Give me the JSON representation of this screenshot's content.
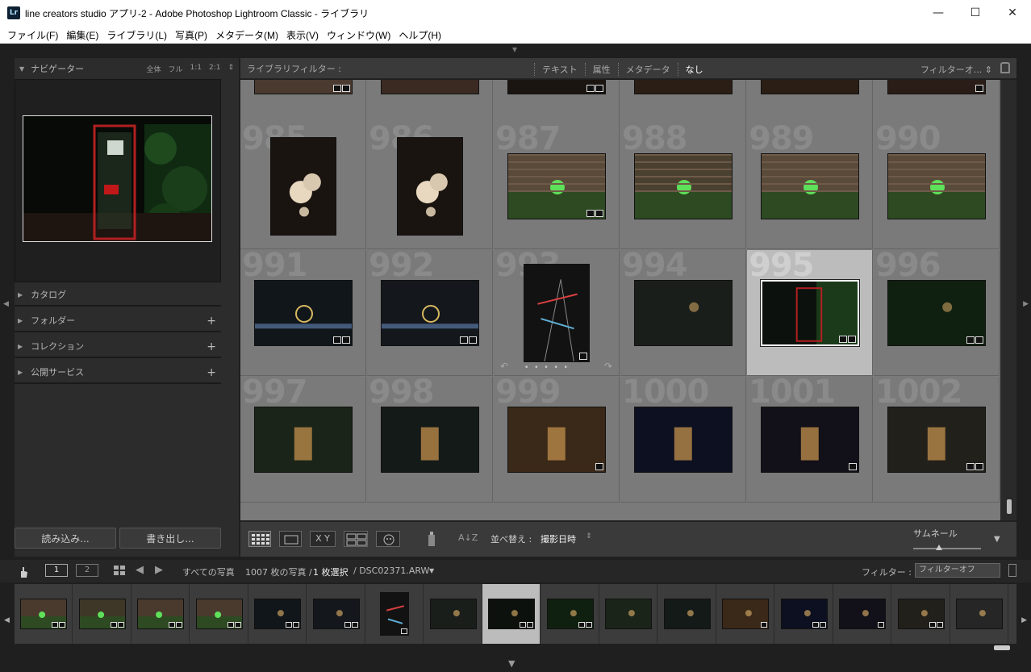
{
  "window": {
    "logo": "Lr",
    "title": "line creators studio アプリ-2 - Adobe Photoshop Lightroom Classic - ライブラリ",
    "minimize": "—",
    "maximize": "☐",
    "close": "✕"
  },
  "menu": [
    "ファイル(F)",
    "編集(E)",
    "ライブラリ(L)",
    "写真(P)",
    "メタデータ(M)",
    "表示(V)",
    "ウィンドウ(W)",
    "ヘルプ(H)"
  ],
  "navigator": {
    "title": "ナビゲーター",
    "options": [
      "全体",
      "フル",
      "1:1",
      "2:1"
    ],
    "spinner": "⇕"
  },
  "sections": [
    {
      "label": "カタログ",
      "plus": ""
    },
    {
      "label": "フォルダー",
      "plus": "+"
    },
    {
      "label": "コレクション",
      "plus": "+"
    },
    {
      "label": "公開サービス",
      "plus": "+"
    }
  ],
  "buttons": {
    "import": "読み込み...",
    "export": "書き出し..."
  },
  "filter_bar": {
    "label": "ライブラリフィルター :",
    "tabs": [
      "テキスト",
      "属性",
      "メタデータ",
      "なし"
    ],
    "active_tab": "なし",
    "preset": "フィルターオ... ⇕"
  },
  "grid": {
    "rows": [
      [
        {
          "num": "",
          "color": "#4a3a30"
        },
        {
          "num": "",
          "color": "#3a2a22"
        },
        {
          "num": "",
          "color": "#1a1510"
        },
        {
          "num": "",
          "color": "#2a1e15"
        },
        {
          "num": "",
          "color": "#2a1e15"
        },
        {
          "num": "",
          "color": "#2a1d18"
        }
      ],
      [
        {
          "num": "985",
          "color": "#1a1410"
        },
        {
          "num": "986",
          "color": "#1a1410"
        },
        {
          "num": "987",
          "color": "#5a4a3a"
        },
        {
          "num": "988",
          "color": "#4a4030"
        },
        {
          "num": "989",
          "color": "#5a4a3a"
        },
        {
          "num": "990",
          "color": "#5a4a3a"
        }
      ],
      [
        {
          "num": "991",
          "color": "#10161a"
        },
        {
          "num": "992",
          "color": "#14181c"
        },
        {
          "num": "993",
          "color": "#121212"
        },
        {
          "num": "994",
          "color": "#1a1e1a"
        },
        {
          "num": "995",
          "color": "#0d110d"
        },
        {
          "num": "996",
          "color": "#102010"
        }
      ],
      [
        {
          "num": "997",
          "color": "#1a2418"
        },
        {
          "num": "998",
          "color": "#141a18"
        },
        {
          "num": "999",
          "color": "#3a2818"
        },
        {
          "num": "1000",
          "color": "#0d1020"
        },
        {
          "num": "1001",
          "color": "#121018"
        },
        {
          "num": "1002",
          "color": "#22201a"
        }
      ]
    ]
  },
  "toolbar": {
    "sort_label": "並べ替え :",
    "sort_value": "撮影日時",
    "sort_arrow": "⇕",
    "thumbnail_label": "サムネール",
    "xy": "X Y",
    "az": "A↓Z"
  },
  "filmstrip_header": {
    "page1": "1",
    "page2": "2",
    "source": "すべての写真",
    "count": "1007 枚の写真 /",
    "selected": "1 枚選択",
    "file": "/ DSC02371.ARW",
    "filter_label": "フィルター :",
    "filter_value": "フィルターオフ"
  },
  "filmstrip": [
    {
      "color": "#4a3a2e"
    },
    {
      "color": "#3e3626"
    },
    {
      "color": "#4a3a2e"
    },
    {
      "color": "#4a3a2e"
    },
    {
      "color": "#10161a"
    },
    {
      "color": "#14181c"
    },
    {
      "color": "#121212"
    },
    {
      "color": "#1a1e1a"
    },
    {
      "color": "#0d110d"
    },
    {
      "color": "#102010"
    },
    {
      "color": "#1a2418"
    },
    {
      "color": "#141a18"
    },
    {
      "color": "#3a2818"
    },
    {
      "color": "#0d1020"
    },
    {
      "color": "#121018"
    },
    {
      "color": "#22201a"
    },
    {
      "color": "#262626"
    }
  ]
}
